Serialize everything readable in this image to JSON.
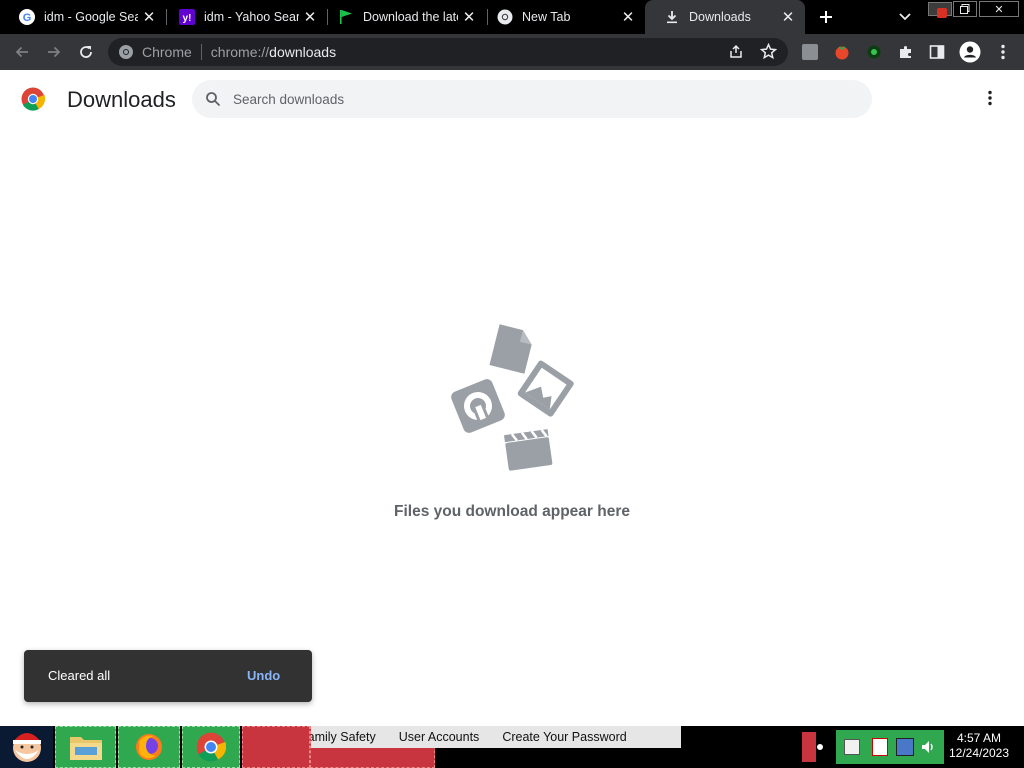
{
  "tabs": [
    {
      "title": "idm - Google Search",
      "favicon": "google-g-icon",
      "active": false
    },
    {
      "title": "idm - Yahoo Search",
      "favicon": "yahoo-icon",
      "active": false
    },
    {
      "title": "Download the latest version",
      "favicon": "green-flag-icon",
      "active": false
    },
    {
      "title": "New Tab",
      "favicon": "chrome-icon",
      "active": false
    },
    {
      "title": "Downloads",
      "favicon": "download-icon",
      "active": true
    }
  ],
  "omnibox": {
    "chip": "Chrome",
    "url_scheme": "chrome://",
    "url_host": "downloads"
  },
  "page": {
    "title": "Downloads",
    "search_placeholder": "Search downloads",
    "empty_message": "Files you download appear here"
  },
  "toast": {
    "message": "Cleared all",
    "action": "Undo"
  },
  "taskbar": {
    "banner_items": [
      "Family Safety",
      "User Accounts",
      "Create Your Password"
    ],
    "clock_time": "4:57 AM",
    "clock_date": "12/24/2023"
  },
  "colors": {
    "titlebar": "#000000",
    "toolbar": "#35363a",
    "omnibox": "#202124",
    "toast": "#323232",
    "link_blue": "#8ab4f8",
    "illustration_gray": "#9aa0a6"
  }
}
